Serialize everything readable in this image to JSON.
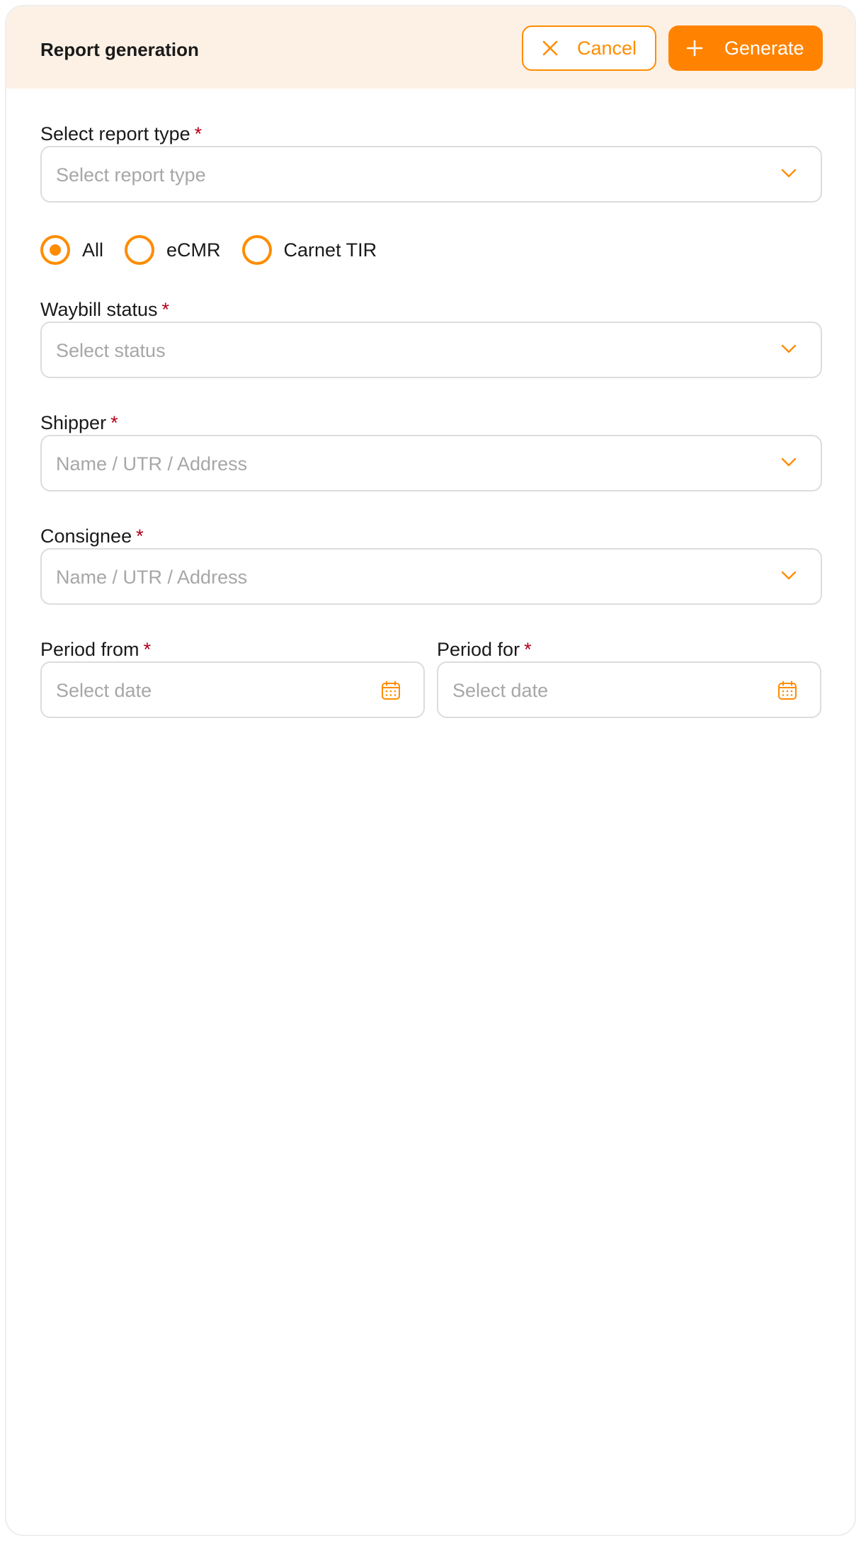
{
  "header": {
    "title": "Report generation",
    "cancel_label": "Cancel",
    "generate_label": "Generate"
  },
  "report_type": {
    "label": "Select report type",
    "required_mark": "*",
    "placeholder": "Select report type"
  },
  "document_filter": {
    "options": [
      {
        "label": "All",
        "selected": true
      },
      {
        "label": "eCMR",
        "selected": false
      },
      {
        "label": "Carnet TIR",
        "selected": false
      }
    ]
  },
  "waybill_status": {
    "label": "Waybill status",
    "required_mark": "*",
    "placeholder": "Select status"
  },
  "shipper": {
    "label": "Shipper",
    "required_mark": "*",
    "placeholder": "Name / UTR / Address"
  },
  "consignee": {
    "label": "Consignee",
    "required_mark": "*",
    "placeholder": "Name / UTR / Address"
  },
  "period_from": {
    "label": "Period from",
    "required_mark": "*",
    "placeholder": "Select date"
  },
  "period_for": {
    "label": "Period for",
    "required_mark": "*",
    "placeholder": "Select date"
  },
  "icons": {
    "cancel": "close-icon",
    "generate": "plus-icon",
    "dropdown": "chevron-down-icon",
    "date": "calendar-icon"
  },
  "colors": {
    "accent": "#ff8300",
    "header_bg": "#fdf1e5",
    "required": "#b3001b",
    "placeholder": "#a7a7a7",
    "border": "#dcdcdc"
  }
}
